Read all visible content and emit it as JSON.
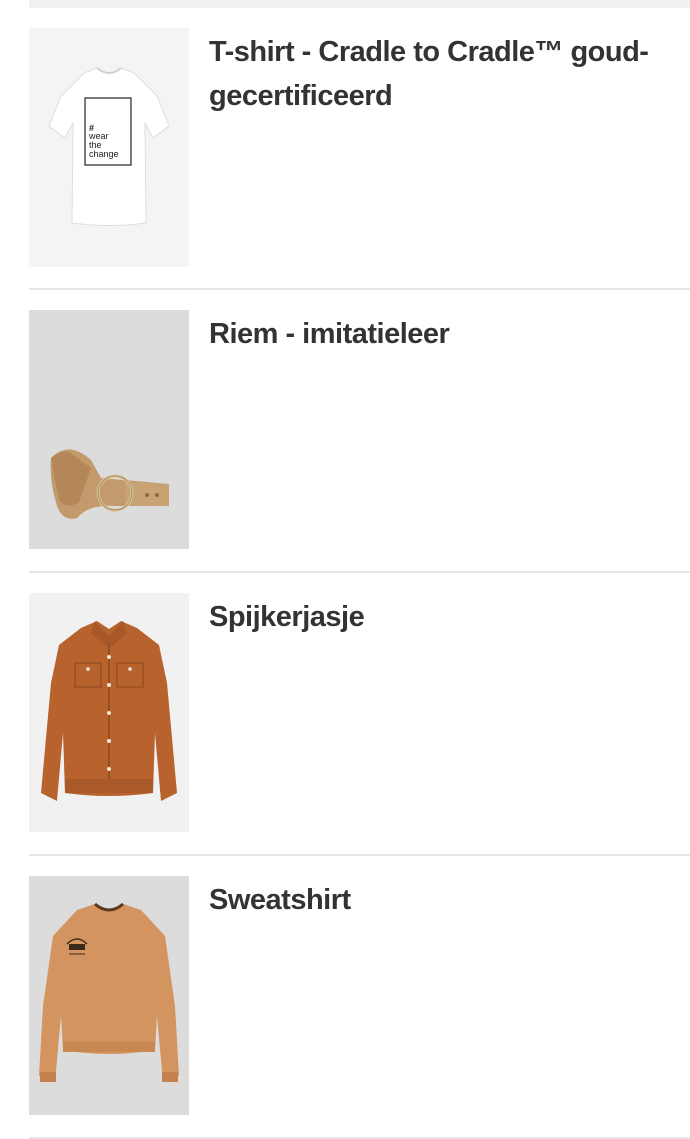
{
  "products": [
    {
      "title": "T-shirt - Cradle to Cradle™ goud-gecertificeerd",
      "image": "white-tshirt-wear-the-change",
      "print_text": "# wear the change"
    },
    {
      "title": "Riem - imitatieleer",
      "image": "tan-belt-ring-buckle"
    },
    {
      "title": "Spijkerjasje",
      "image": "rust-denim-jacket"
    },
    {
      "title": "Sweatshirt",
      "image": "tan-cropped-sweatshirt"
    }
  ],
  "colors": {
    "text": "#333333",
    "divider": "#e6e6e6",
    "image_bg_light": "#f4f4f4",
    "image_bg_grey": "#dcdcdc"
  }
}
